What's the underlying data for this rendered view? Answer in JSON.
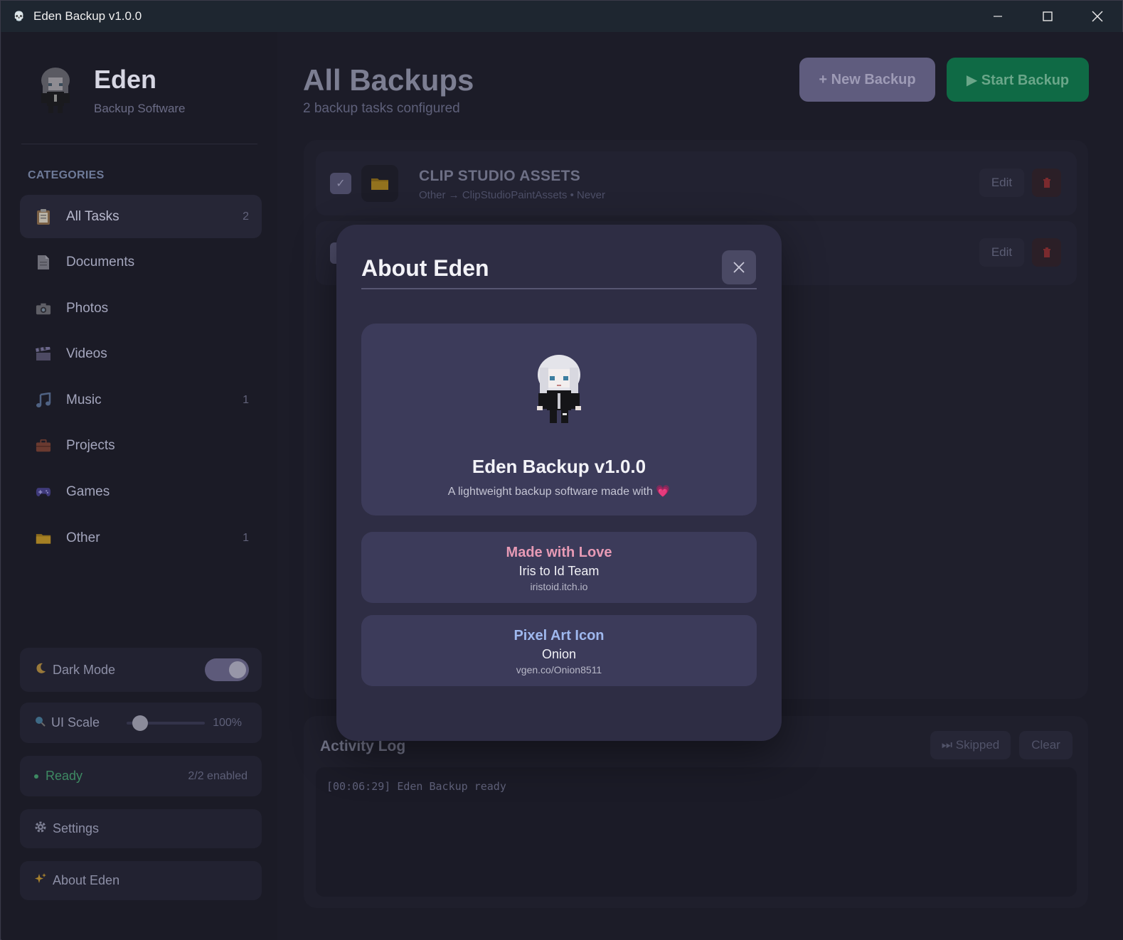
{
  "window": {
    "title": "Eden Backup v1.0.0",
    "minimize_icon": "minimize-icon",
    "maximize_icon": "maximize-icon",
    "close_icon": "close-icon"
  },
  "sidebar": {
    "brand_name": "Eden",
    "brand_sub": "Backup Software",
    "categories_heading": "CATEGORIES",
    "items": [
      {
        "label": "All Tasks",
        "count": "2",
        "icon": "clipboard-icon"
      },
      {
        "label": "Documents",
        "count": "",
        "icon": "document-icon"
      },
      {
        "label": "Photos",
        "count": "",
        "icon": "camera-icon"
      },
      {
        "label": "Videos",
        "count": "",
        "icon": "clapper-icon"
      },
      {
        "label": "Music",
        "count": "1",
        "icon": "music-note-icon"
      },
      {
        "label": "Projects",
        "count": "",
        "icon": "briefcase-icon"
      },
      {
        "label": "Games",
        "count": "",
        "icon": "gamepad-icon"
      },
      {
        "label": "Other",
        "count": "1",
        "icon": "folder-icon"
      }
    ],
    "dark_mode_label": "Dark Mode",
    "dark_mode_on": true,
    "ui_scale_label": "UI Scale",
    "ui_scale_value": "100%",
    "status_text": "Ready",
    "status_count": "2/2 enabled",
    "settings_label": "Settings",
    "about_label": "About Eden"
  },
  "main": {
    "title": "All Backups",
    "subtitle": "2 backup tasks configured",
    "new_backup_label": "+ New Backup",
    "start_backup_label": "▶ Start Backup",
    "tasks": [
      {
        "name": "CLIP STUDIO ASSETS",
        "meta": "Other → ClipStudioPaintAssets • Never",
        "edit_label": "Edit"
      },
      {
        "name": "",
        "meta": "",
        "edit_label": "Edit"
      }
    ],
    "log_title": "Activity Log",
    "skipped_label": "⏭ Skipped",
    "clear_label": "Clear",
    "log_lines": [
      "[00:06:29] Eden Backup ready"
    ]
  },
  "modal": {
    "title": "About Eden",
    "app_name": "Eden Backup v1.0.0",
    "tagline": "A lightweight backup software made with",
    "heart": "💗",
    "credits": [
      {
        "title": "Made with Love",
        "name": "Iris to Id Team",
        "link": "iristoid.itch.io"
      },
      {
        "title": "Pixel Art Icon",
        "name": "Onion",
        "link": "vgen.co/Onion8511"
      }
    ]
  },
  "colors": {
    "accent_green": "#0f6a45",
    "accent_purple": "#5f5c7e",
    "love_pink": "#e79ab5",
    "pixel_blue": "#9fb8ee",
    "status_green": "#3e8a63"
  }
}
